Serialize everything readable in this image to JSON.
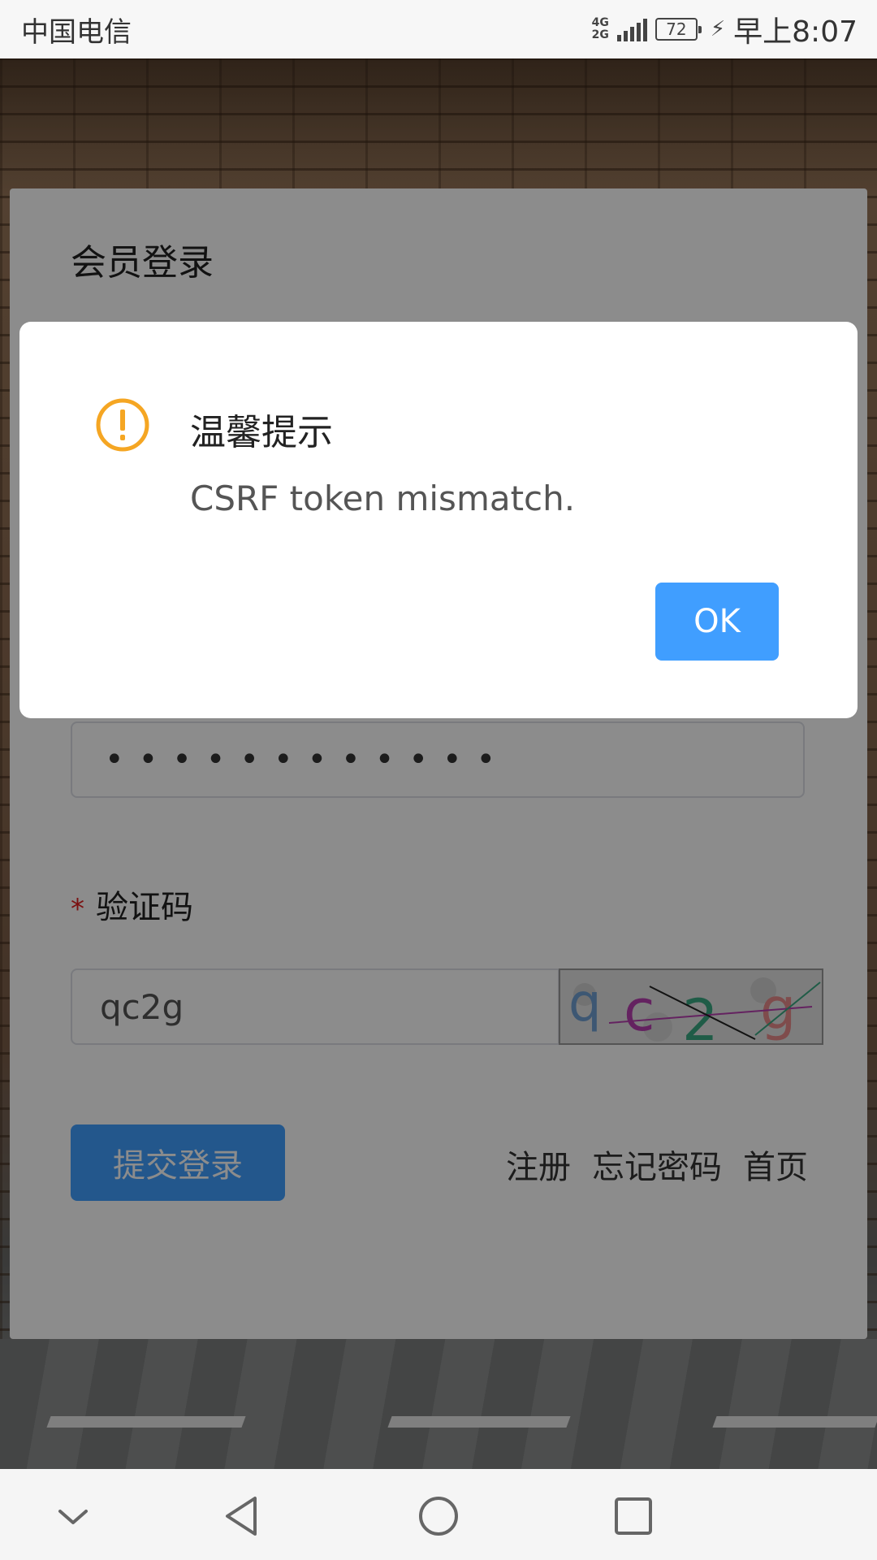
{
  "status_bar": {
    "carrier": "中国电信",
    "network_top": "4G",
    "network_bottom": "2G",
    "battery": "72",
    "time": "早上8:07"
  },
  "login": {
    "title": "会员登录",
    "password_mask": "••••••••••••",
    "captcha_label": "验证码",
    "captcha_required_mark": "*",
    "captcha_value": "qc2g",
    "captcha_image_text": [
      "q",
      "c",
      "2",
      "g"
    ],
    "submit_label": "提交登录",
    "links": [
      "注册",
      "忘记密码",
      "首页"
    ]
  },
  "dialog": {
    "title": "温馨提示",
    "message": "CSRF token mismatch.",
    "ok_label": "OK",
    "icon": "warning-icon"
  },
  "nav_bar": {
    "buttons": [
      "collapse-icon",
      "back-icon",
      "home-icon",
      "recents-icon"
    ]
  },
  "colors": {
    "primary": "#409eff",
    "warning": "#f5a623",
    "overlay": "rgba(0,0,0,0.45)"
  }
}
